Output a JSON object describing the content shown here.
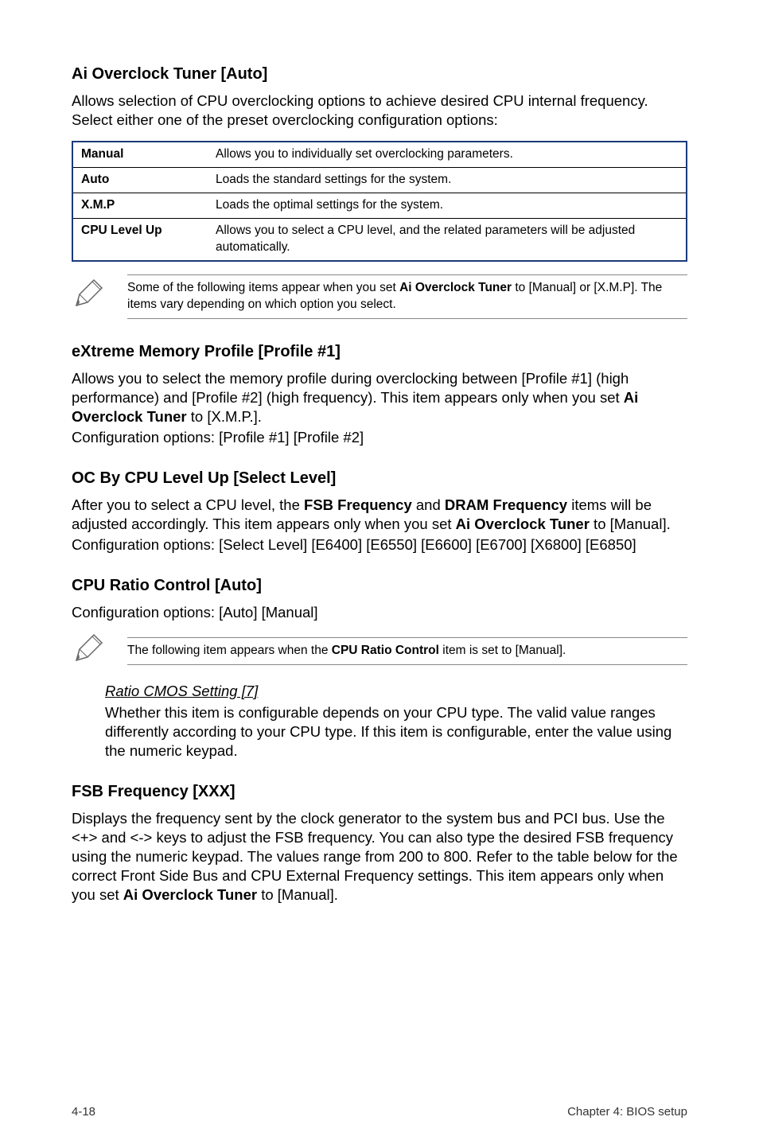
{
  "s1": {
    "heading": "Ai Overclock Tuner [Auto]",
    "intro": "Allows selection of CPU overclocking options to achieve desired CPU internal frequency. Select either one of the preset overclocking configuration options:",
    "table": [
      {
        "name": "Manual",
        "desc": "Allows you to individually set overclocking parameters."
      },
      {
        "name": "Auto",
        "desc": "Loads the standard settings for the system."
      },
      {
        "name": "X.M.P",
        "desc": "Loads the optimal settings for the system."
      },
      {
        "name": "CPU Level Up",
        "desc": "Allows you to select a CPU level, and the related parameters will be adjusted automatically."
      }
    ],
    "note_pre": "Some of the following items appear when you set ",
    "note_bold": "Ai Overclock Tuner",
    "note_post": " to [Manual] or [X.M.P]. The items vary depending on which option you select."
  },
  "s2": {
    "heading": "eXtreme Memory Profile [Profile #1]",
    "body_p1": "Allows you to select the memory profile during overclocking between [Profile #1] (high performance) and [Profile #2] (high frequency). This item appears only when you set ",
    "body_bold": "Ai Overclock Tuner",
    "body_p2": " to [X.M.P.].",
    "config": "Configuration options: [Profile #1] [Profile #2]"
  },
  "s3": {
    "heading": "OC By CPU Level Up [Select Level]",
    "body_p1": "After you to select a CPU level, the ",
    "bold1": "FSB Frequency",
    "body_p2": " and ",
    "bold2": "DRAM Frequency",
    "body_p3": " items will be adjusted accordingly. This item appears only when you set ",
    "bold3": "Ai Overclock Tuner",
    "body_p4": " to [Manual].",
    "config": "Configuration options: [Select Level] [E6400] [E6550] [E6600] [E6700] [X6800] [E6850]"
  },
  "s4": {
    "heading": "CPU Ratio Control [Auto]",
    "config": "Configuration options: [Auto] [Manual]",
    "note_pre": "The following item appears when the ",
    "note_bold": "CPU Ratio Control",
    "note_post": " item is set to [Manual].",
    "sub_heading": "Ratio CMOS Setting [7]",
    "sub_body": "Whether this item is configurable depends on your CPU type. The valid value ranges differently according to your CPU type. If this item is configurable, enter the value using the numeric keypad."
  },
  "s5": {
    "heading": "FSB Frequency [XXX]",
    "body_p1": "Displays the frequency sent by the clock generator to the system bus and PCI bus. Use the <+> and <-> keys to adjust the FSB frequency. You can also type the desired FSB frequency using the numeric keypad. The values range from 200 to 800. Refer to the table below for the correct Front Side Bus and CPU External Frequency settings. This item appears only when you set ",
    "bold1": "Ai Overclock Tuner",
    "body_p2": " to [Manual]."
  },
  "footer": {
    "left": "4-18",
    "right": "Chapter 4: BIOS setup"
  }
}
